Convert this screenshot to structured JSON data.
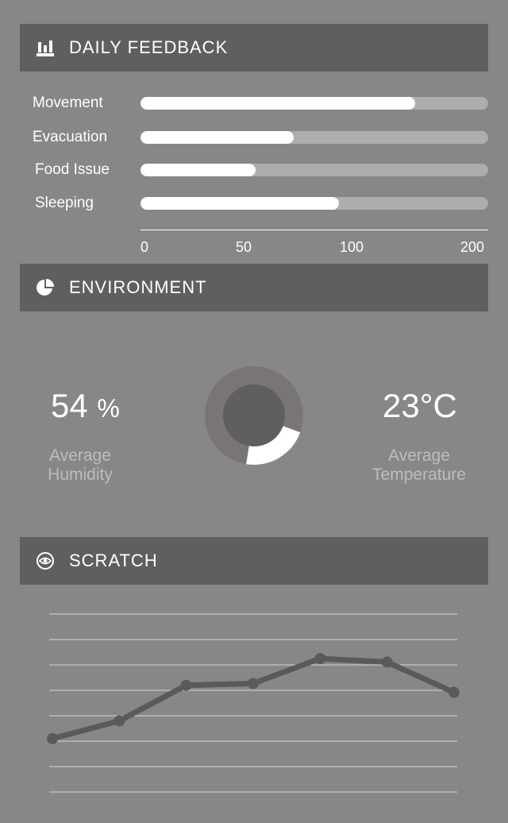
{
  "daily_feedback": {
    "title": "DAILY FEEDBACK",
    "icon": "bar-chart-icon",
    "rows": [
      {
        "label": "Movement",
        "value": 0.79
      },
      {
        "label": "Evacuation",
        "value": 0.44
      },
      {
        "label": "Food Issue",
        "value": 0.33
      },
      {
        "label": "Sleeping",
        "value": 0.57
      }
    ],
    "axis_ticks": [
      "0",
      "50",
      "100",
      "200"
    ]
  },
  "environment": {
    "title": "ENVIRONMENT",
    "icon": "pie-chart-icon",
    "humidity_value": "54",
    "humidity_unit": "%",
    "humidity_caption": "Average Humidity",
    "temperature_value": "23°C",
    "temperature_caption": "Average Temperature",
    "donut_fraction": 0.22,
    "colors": {
      "ring": "#787574",
      "inner": "#5f5f5f",
      "highlight": "#ffffff"
    }
  },
  "scratch": {
    "title": "SCRATCH",
    "icon": "eye-icon"
  },
  "chart_data": {
    "type": "line",
    "title": "",
    "x": [
      "",
      "",
      "",
      "",
      "",
      "",
      ""
    ],
    "series": [
      {
        "values": [
          10,
          20,
          40,
          41,
          55,
          53,
          36
        ],
        "color": "#5a5a5a"
      }
    ],
    "ylim": [
      -20,
      80
    ],
    "grid": true
  },
  "colors": {
    "background": "#878787",
    "header": "#5f5f5f",
    "track": "#adadad",
    "fill": "#ffffff"
  }
}
